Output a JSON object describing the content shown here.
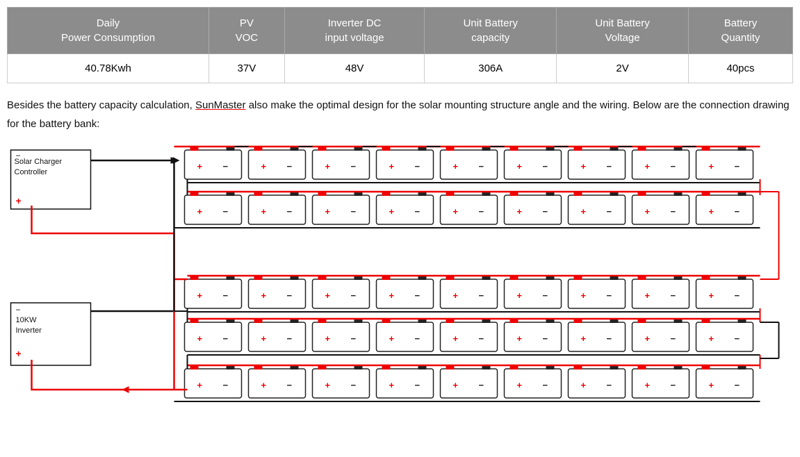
{
  "table": {
    "headers": [
      "Daily\nPower Consumption",
      "PV\nVOC",
      "Inverter DC\ninput voltage",
      "Unit Battery\ncapacity",
      "Unit Battery\nVoltage",
      "Battery\nQuantity"
    ],
    "row": [
      "40.78Kwh",
      "37V",
      "48V",
      "306A",
      "2V",
      "40pcs"
    ]
  },
  "description": {
    "text_before": "Besides the battery capacity calculation, ",
    "link": "SunMaster",
    "text_after": " also make the optimal design for the solar mounting structure angle and the wiring. Below are the connection drawing for the battery bank:"
  },
  "diagram": {
    "solar_charger_label": "Solar Charger\nController",
    "inverter_label": "10KW\nInverter"
  }
}
